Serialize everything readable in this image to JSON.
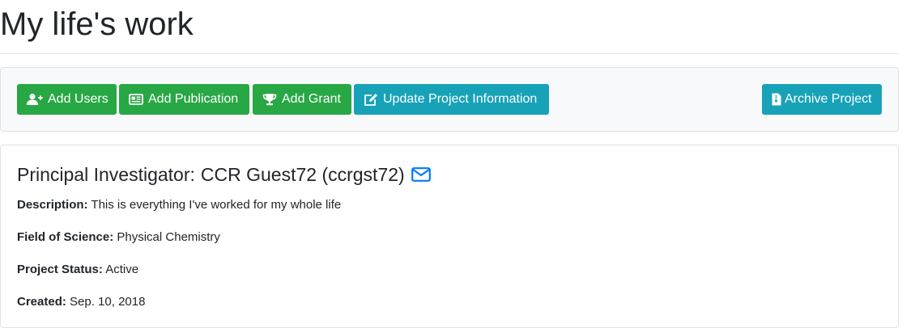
{
  "page": {
    "title": "My life's work"
  },
  "toolbar": {
    "add_users": "Add Users",
    "add_publication": "Add Publication",
    "add_grant": "Add Grant",
    "update_project": "Update Project Information",
    "archive_project": "Archive Project"
  },
  "project": {
    "pi_label": "Principal Investigator:",
    "pi_name": "CCR Guest72 (ccrgst72)",
    "fields": {
      "description": {
        "label": "Description:",
        "value": "This is everything I've worked for my whole life"
      },
      "field_of_science": {
        "label": "Field of Science:",
        "value": "Physical Chemistry"
      },
      "status": {
        "label": "Project Status:",
        "value": "Active"
      },
      "created": {
        "label": "Created:",
        "value": "Sep. 10, 2018"
      }
    }
  },
  "colors": {
    "success": "#28a745",
    "info": "#17a2b8",
    "link": "#007bff"
  },
  "icons": [
    "user-plus-icon",
    "newspaper-icon",
    "trophy-icon",
    "edit-icon",
    "archive-file-icon",
    "envelope-icon"
  ]
}
